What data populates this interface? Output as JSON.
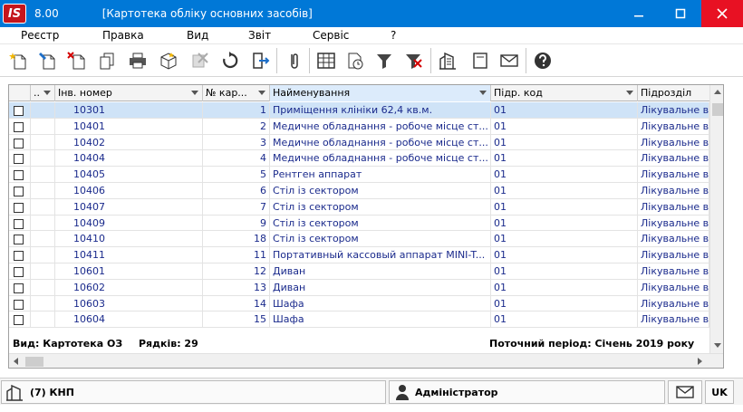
{
  "app": {
    "logo": "IS",
    "version": "8.00",
    "window_title": "[Картотека обліку основних засобів]"
  },
  "menu": [
    "Реєстр",
    "Правка",
    "Вид",
    "Звіт",
    "Сервіс",
    "?"
  ],
  "toolbar": [
    "add-new-icon",
    "edit-icon",
    "delete-icon",
    "copy-icon",
    "print-icon",
    "package-icon",
    "disabled-tool-icon",
    "refresh-icon",
    "exit-icon",
    "attach-icon",
    "table-view-icon",
    "calendar-clock-icon",
    "filter-icon",
    "clear-filter-icon",
    "building-icon",
    "document-icon",
    "mail-icon",
    "help-icon"
  ],
  "grid": {
    "columns": [
      "..",
      "Інв. номер",
      "№ кар...",
      "Найменування",
      "Підр. код",
      "Підрозділ"
    ],
    "rows": [
      {
        "inv": "10301",
        "card": "1",
        "name": "Приміщення клініки 62,4 кв.м.",
        "code": "01",
        "unit": "Лікувальне в"
      },
      {
        "inv": "10401",
        "card": "2",
        "name": "Медичне обладнання - робоче місце ст...",
        "code": "01",
        "unit": "Лікувальне в"
      },
      {
        "inv": "10402",
        "card": "3",
        "name": "Медичне обладнання - робоче місце ст...",
        "code": "01",
        "unit": "Лікувальне в"
      },
      {
        "inv": "10404",
        "card": "4",
        "name": "Медичне обладнання - робоче місце ст...",
        "code": "01",
        "unit": "Лікувальне в"
      },
      {
        "inv": "10405",
        "card": "5",
        "name": "Рентген аппарат",
        "code": "01",
        "unit": "Лікувальне в"
      },
      {
        "inv": "10406",
        "card": "6",
        "name": "Стіл із сектором",
        "code": "01",
        "unit": "Лікувальне в"
      },
      {
        "inv": "10407",
        "card": "7",
        "name": "Стіл із сектором",
        "code": "01",
        "unit": "Лікувальне в"
      },
      {
        "inv": "10409",
        "card": "9",
        "name": "Стіл із сектором",
        "code": "01",
        "unit": "Лікувальне в"
      },
      {
        "inv": "10410",
        "card": "18",
        "name": "Стіл із сектором",
        "code": "01",
        "unit": "Лікувальне в"
      },
      {
        "inv": "10411",
        "card": "11",
        "name": "Портативный кассовый аппарат MINI-T...",
        "code": "01",
        "unit": "Лікувальне в"
      },
      {
        "inv": "10601",
        "card": "12",
        "name": "Диван",
        "code": "01",
        "unit": "Лікувальне в"
      },
      {
        "inv": "10602",
        "card": "13",
        "name": "Диван",
        "code": "01",
        "unit": "Лікувальне в"
      },
      {
        "inv": "10603",
        "card": "14",
        "name": "Шафа",
        "code": "01",
        "unit": "Лікувальне в"
      },
      {
        "inv": "10604",
        "card": "15",
        "name": "Шафа",
        "code": "01",
        "unit": "Лікувальне в"
      }
    ]
  },
  "footer": {
    "view": "Вид: Картотека ОЗ",
    "rows": "Рядків: 29",
    "period": "Поточний період: Січень 2019 року"
  },
  "status": {
    "org": "(7) КНП",
    "user": "Адміністратор",
    "lang": "UK"
  },
  "colors": {
    "titlebar": "#0078d7",
    "close": "#e81123",
    "selection": "#cfe3f7",
    "cell_text": "#1a2a8c"
  }
}
